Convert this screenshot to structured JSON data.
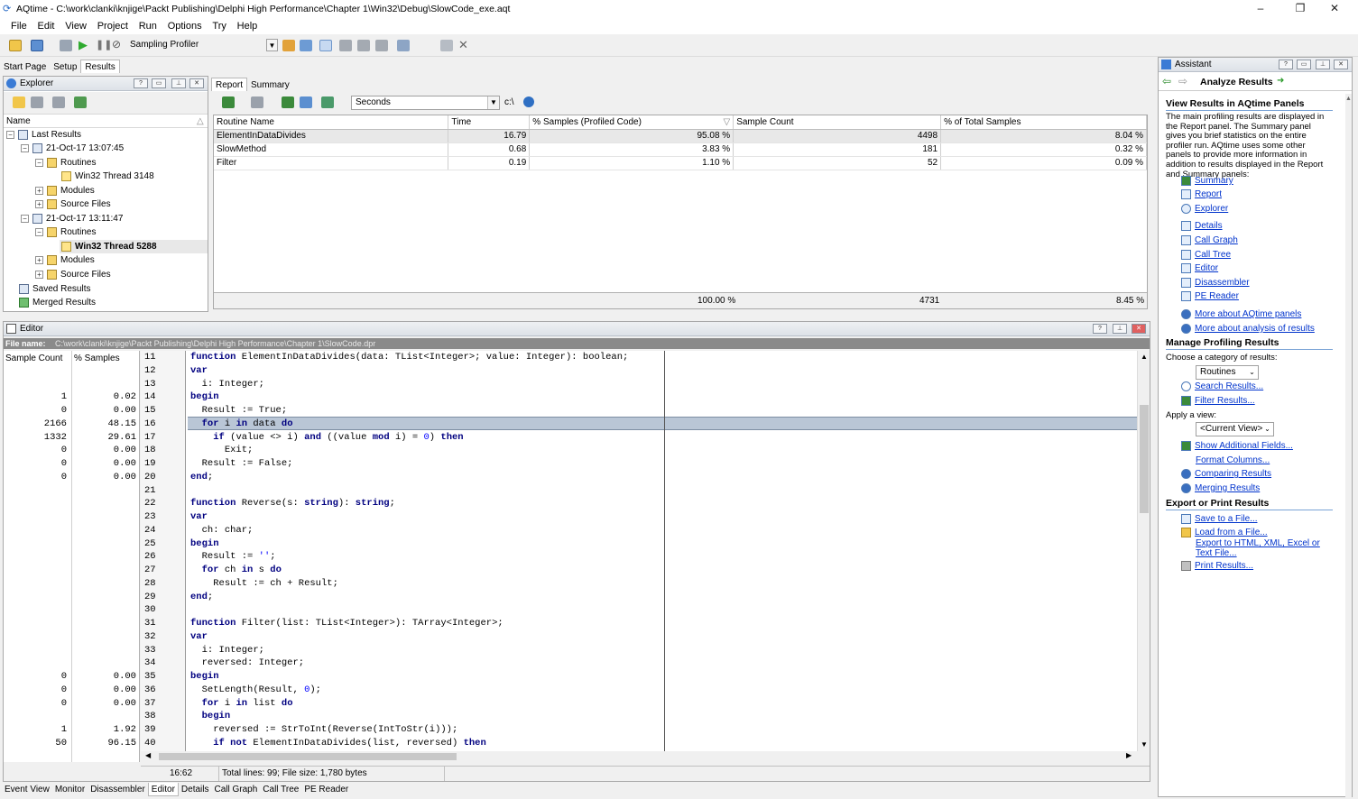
{
  "window": {
    "title": "AQtime - C:\\work\\clanki\\knjige\\Packt Publishing\\Delphi High Performance\\Chapter 1\\Win32\\Debug\\SlowCode_exe.aqt",
    "min": "–",
    "max": "❐",
    "close": "✕"
  },
  "menu": [
    "File",
    "Edit",
    "View",
    "Project",
    "Run",
    "Options",
    "Try",
    "Help"
  ],
  "toolbar": {
    "profiler": "Sampling Profiler"
  },
  "main_tabs": [
    "Start Page",
    "Setup",
    "Results"
  ],
  "explorer": {
    "title": "Explorer",
    "column": "Name",
    "tree": {
      "last_results": "Last Results",
      "run1": "21-Oct-17 13:07:45",
      "routines1": "Routines",
      "thread1": "Win32 Thread 3148",
      "modules1": "Modules",
      "source1": "Source Files",
      "run2": "21-Oct-17 13:11:47",
      "routines2": "Routines",
      "thread2": "Win32 Thread 5288",
      "modules2": "Modules",
      "source2": "Source Files",
      "saved": "Saved Results",
      "merged": "Merged Results"
    }
  },
  "report": {
    "tabs": [
      "Report",
      "Summary"
    ],
    "units": "Seconds",
    "path_btn": "c:\\",
    "columns": [
      "Routine Name",
      "Time",
      "% Samples (Profiled Code)",
      "Sample Count",
      "% of Total Samples"
    ],
    "rows": [
      [
        "ElementInDataDivides",
        "16.79",
        "95.08 %",
        "4498",
        "8.04 %"
      ],
      [
        "SlowMethod",
        "0.68",
        "3.83 %",
        "181",
        "0.32 %"
      ],
      [
        "Filter",
        "0.19",
        "1.10 %",
        "52",
        "0.09 %"
      ]
    ],
    "footer": [
      "100.00 %",
      "4731",
      "8.45 %"
    ]
  },
  "editor": {
    "title": "Editor",
    "file_label": "File name:",
    "file_path": "C:\\work\\clanki\\knjige\\Packt Publishing\\Delphi High Performance\\Chapter 1\\SlowCode.dpr",
    "col_sample_count": "Sample Count",
    "col_samples": "% Samples",
    "lines": [
      {
        "n": "11",
        "sc": "",
        "pct": "",
        "code": "function ElementInDataDivides(data: TList<Integer>; value: Integer): boolean;"
      },
      {
        "n": "12",
        "sc": "",
        "pct": "",
        "code": "var"
      },
      {
        "n": "13",
        "sc": "",
        "pct": "",
        "code": "  i: Integer;"
      },
      {
        "n": "14",
        "sc": "1",
        "pct": "0.02",
        "code": "begin"
      },
      {
        "n": "15",
        "sc": "0",
        "pct": "0.00",
        "code": "  Result := True;"
      },
      {
        "n": "16",
        "sc": "2166",
        "pct": "48.15",
        "code": "  for i in data do"
      },
      {
        "n": "17",
        "sc": "1332",
        "pct": "29.61",
        "code": "    if (value <> i) and ((value mod i) = 0) then"
      },
      {
        "n": "18",
        "sc": "0",
        "pct": "0.00",
        "code": "      Exit;"
      },
      {
        "n": "19",
        "sc": "0",
        "pct": "0.00",
        "code": "  Result := False;"
      },
      {
        "n": "20",
        "sc": "0",
        "pct": "0.00",
        "code": "end;"
      },
      {
        "n": "21",
        "sc": "",
        "pct": "",
        "code": ""
      },
      {
        "n": "22",
        "sc": "",
        "pct": "",
        "code": "function Reverse(s: string): string;"
      },
      {
        "n": "23",
        "sc": "",
        "pct": "",
        "code": "var"
      },
      {
        "n": "24",
        "sc": "",
        "pct": "",
        "code": "  ch: char;"
      },
      {
        "n": "25",
        "sc": "",
        "pct": "",
        "code": "begin"
      },
      {
        "n": "26",
        "sc": "",
        "pct": "",
        "code": "  Result := '';"
      },
      {
        "n": "27",
        "sc": "",
        "pct": "",
        "code": "  for ch in s do"
      },
      {
        "n": "28",
        "sc": "",
        "pct": "",
        "code": "    Result := ch + Result;"
      },
      {
        "n": "29",
        "sc": "",
        "pct": "",
        "code": "end;"
      },
      {
        "n": "30",
        "sc": "",
        "pct": "",
        "code": ""
      },
      {
        "n": "31",
        "sc": "",
        "pct": "",
        "code": "function Filter(list: TList<Integer>): TArray<Integer>;"
      },
      {
        "n": "32",
        "sc": "",
        "pct": "",
        "code": "var"
      },
      {
        "n": "33",
        "sc": "",
        "pct": "",
        "code": "  i: Integer;"
      },
      {
        "n": "34",
        "sc": "",
        "pct": "",
        "code": "  reversed: Integer;"
      },
      {
        "n": "35",
        "sc": "0",
        "pct": "0.00",
        "code": "begin"
      },
      {
        "n": "36",
        "sc": "0",
        "pct": "0.00",
        "code": "  SetLength(Result, 0);"
      },
      {
        "n": "37",
        "sc": "0",
        "pct": "0.00",
        "code": "  for i in list do"
      },
      {
        "n": "38",
        "sc": "",
        "pct": "",
        "code": "  begin"
      },
      {
        "n": "39",
        "sc": "1",
        "pct": "1.92",
        "code": "    reversed := StrToInt(Reverse(IntToStr(i)));"
      },
      {
        "n": "40",
        "sc": "50",
        "pct": "96.15",
        "code": "    if not ElementInDataDivides(list, reversed) then"
      }
    ],
    "status_pos": "16:62",
    "status_info": "Total lines: 99; File size: 1,780 bytes"
  },
  "bottom_tabs": [
    "Event View",
    "Monitor",
    "Disassembler",
    "Editor",
    "Details",
    "Call Graph",
    "Call Tree",
    "PE Reader"
  ],
  "assistant": {
    "title": "Assistant",
    "heading": "Analyze Results",
    "sec1": "View Results in AQtime Panels",
    "desc": "The main profiling results are displayed in the Report panel. The Summary panel gives you brief statistics on the entire profiler run. AQtime uses some other panels to provide more information in addition to results displayed in the Report and Summary panels:",
    "panels": [
      "Summary",
      "Report",
      "Explorer",
      "Details",
      "Call Graph",
      "Call Tree",
      "Editor",
      "Disassembler",
      "PE Reader"
    ],
    "more1": "More about AQtime panels",
    "more2": "More about analysis of results",
    "sec2": "Manage Profiling Results",
    "choose": "Choose a category of results:",
    "category": "Routines",
    "search": "Search Results...",
    "filter": "Filter Results...",
    "apply": "Apply a view:",
    "view": "<Current View>",
    "show_fields": "Show Additional Fields...",
    "format_cols": "Format Columns...",
    "comparing": "Comparing Results",
    "merging": "Merging Results",
    "sec3": "Export or Print Results",
    "save": "Save to a File...",
    "load": "Load from a File...",
    "export": "Export to HTML, XML, Excel or Text File...",
    "print": "Print Results..."
  }
}
